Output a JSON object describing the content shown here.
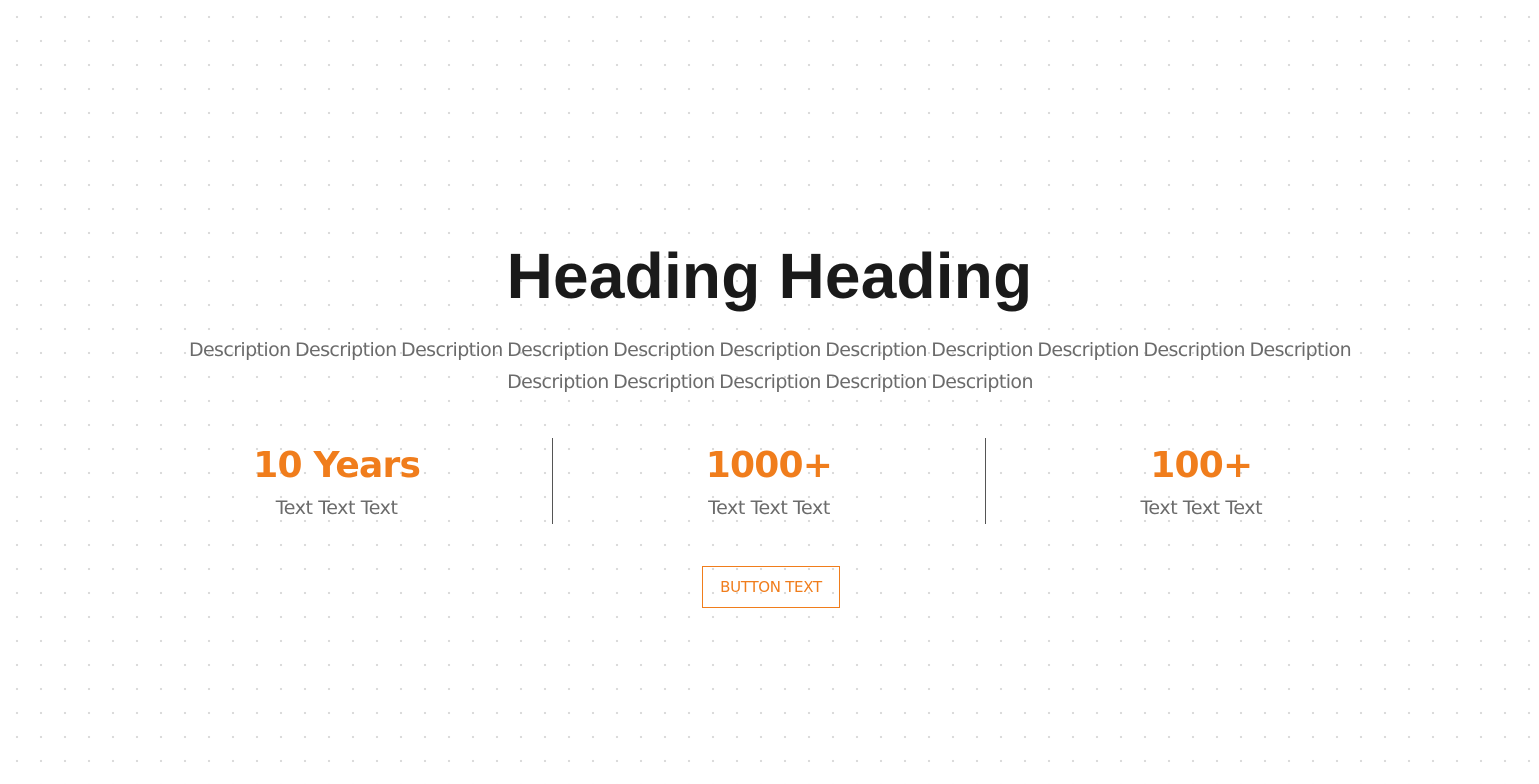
{
  "hero": {
    "heading": "Heading Heading",
    "description": "Description Description Description Description Description Description Description Description Description Description Description Description Description Description Description Description",
    "stats": [
      {
        "value": "10 Years",
        "label": "Text Text Text"
      },
      {
        "value": "1000+",
        "label": "Text Text Text"
      },
      {
        "value": "100+",
        "label": "Text Text Text"
      }
    ],
    "button_label": "BUTTON TEXT"
  },
  "colors": {
    "accent": "#f07d1c",
    "heading": "#1a1a1a",
    "body_text": "#6b6b6b",
    "divider": "#555555",
    "background": "#ffffff"
  }
}
